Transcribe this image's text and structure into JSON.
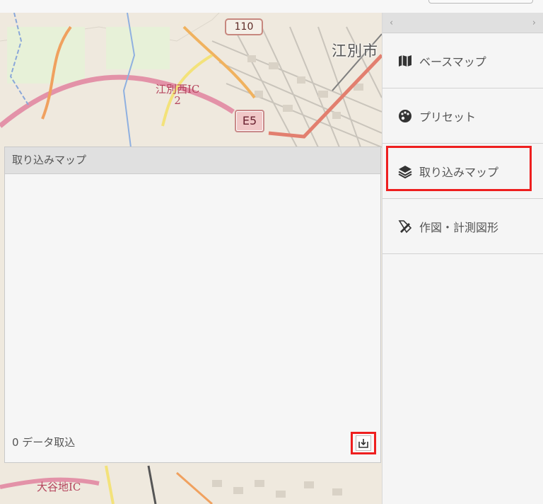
{
  "map": {
    "city_label": "江別市",
    "route_shield": "110",
    "expressway_shield": "E5",
    "ic_label_top": "江別西IC",
    "ic_number_top": "2",
    "ic_label_bottom": "大谷地IC"
  },
  "panel": {
    "title": "取り込みマップ",
    "data_count_label": "0 データ取込",
    "import_icon": "download-icon"
  },
  "sidebar": {
    "scroll_left": "‹",
    "scroll_right": "›",
    "items": [
      {
        "label": "ベースマップ",
        "icon": "map-icon"
      },
      {
        "label": "プリセット",
        "icon": "palette-icon"
      },
      {
        "label": "取り込みマップ",
        "icon": "layers-icon"
      },
      {
        "label": "作図・計測図形",
        "icon": "pencil-ruler-icon"
      }
    ]
  },
  "colors": {
    "highlight": "#ee1f1f",
    "panel_header": "#e0e0e0",
    "map_background": "#efe9de"
  }
}
